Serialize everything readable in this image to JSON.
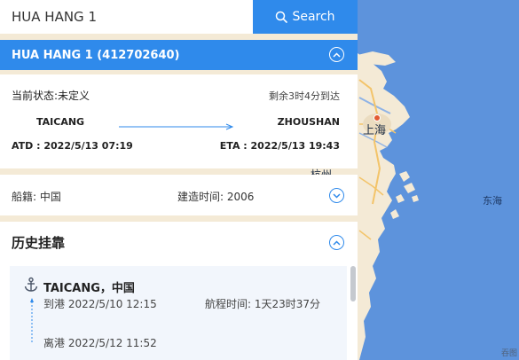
{
  "search": {
    "value": "HUA HANG 1",
    "button_label": "Search",
    "button_icon": "search-icon"
  },
  "ship": {
    "title": "HUA HANG 1 (412702640)",
    "status": "当前状态:未定义",
    "eta_remaining": "剩余3时4分到达",
    "origin": "TAICANG",
    "destination": "ZHOUSHAN",
    "atd": "ATD : 2022/5/13 07:19",
    "eta": "ETA : 2022/5/13 19:43",
    "flag": "船籍:  中国",
    "built": "建造时间:  2006"
  },
  "history": {
    "title": "历史挂靠",
    "items": [
      {
        "port": "TAICANG，中国",
        "arrive": "到港 2022/5/10 12:15",
        "duration": "航程时间: 1天23时37分",
        "depart": "离港 2022/5/12 11:52"
      }
    ]
  },
  "map": {
    "city_label": "上海",
    "sea_label": "东海",
    "partial_label": "杭州",
    "watermark": "吞图",
    "land_color": "#f4ead6",
    "sea_color": "#5d93dc",
    "marker_color": "#d22a2a"
  },
  "colors": {
    "accent": "#2f8aeb"
  }
}
